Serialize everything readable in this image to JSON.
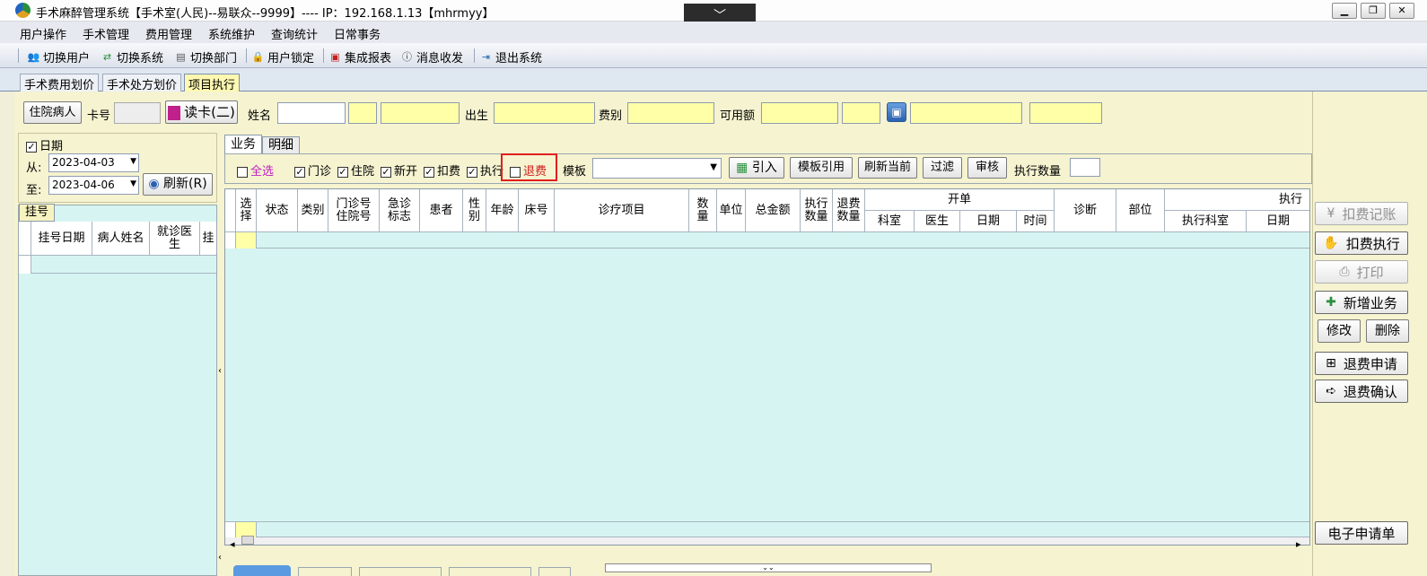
{
  "window": {
    "title": "手术麻醉管理系统【手术室(人民)--易联众--9999】---- IP：192.168.1.13【mhrmyy】",
    "dropdown_glyph": "﹀",
    "controls": [
      "▁",
      "❐",
      "✕"
    ]
  },
  "menu": [
    "用户操作",
    "手术管理",
    "费用管理",
    "系统维护",
    "查询统计",
    "日常事务"
  ],
  "toolbar": [
    {
      "label": "切换用户",
      "icon": "users-icon"
    },
    {
      "label": "切换系统",
      "icon": "switch-system-icon"
    },
    {
      "label": "切换部门",
      "icon": "department-icon"
    },
    {
      "label": "用户锁定",
      "icon": "lock-user-icon"
    },
    {
      "label": "集成报表",
      "icon": "report-icon"
    },
    {
      "label": "消息收发",
      "icon": "message-icon"
    },
    {
      "label": "退出系统",
      "icon": "exit-icon"
    }
  ],
  "main_tabs": [
    "手术费用划价",
    "手术处方划价",
    "项目执行"
  ],
  "patient_bar": {
    "patient_type_button": "住院病人",
    "card_label": "卡号",
    "read_card_button": "读卡(二)",
    "name_label": "姓名",
    "birth_label": "出生",
    "fee_type_label": "费别",
    "available_label": "可用额"
  },
  "date_panel": {
    "date_checkbox": "日期",
    "from_label": "从:",
    "from_value": "2023-04-03",
    "to_label": "至:",
    "to_value": "2023-04-06",
    "refresh_button": "刷新(R)"
  },
  "registration": {
    "tab": "挂号",
    "columns": [
      "挂号日期",
      "病人姓名",
      "就诊医生",
      "挂"
    ]
  },
  "sub_tabs": [
    "业务",
    "明细"
  ],
  "filters": {
    "select_all": "全选",
    "checkboxes": [
      "门诊",
      "住院",
      "新开",
      "扣费",
      "执行"
    ],
    "refund": "退费",
    "template_label": "模板",
    "import_button": "引入",
    "template_ref_button": "模板引用",
    "refresh_current_button": "刷新当前",
    "filter_button": "过滤",
    "audit_button": "审核",
    "exec_count_label": "执行数量"
  },
  "grid": {
    "columns": [
      "选择",
      "状态",
      "类别",
      "门诊号住院号",
      "急诊标志",
      "患者",
      "性别",
      "年龄",
      "床号",
      "诊疗项目",
      "数量",
      "单位",
      "总金额",
      "执行数量",
      "退费数量"
    ],
    "group_order": "开单",
    "order_sub": [
      "科室",
      "医生",
      "日期",
      "时间"
    ],
    "diagnosis": "诊断",
    "site": "部位",
    "group_exec": "执行",
    "exec_sub": [
      "执行科室",
      "日期"
    ]
  },
  "side_buttons": [
    {
      "label": "扣费记账",
      "enabled": false,
      "icon": "yen-icon"
    },
    {
      "label": "扣费执行",
      "enabled": true,
      "icon": "hand-icon"
    },
    {
      "label": "打印",
      "enabled": false,
      "icon": "printer-icon"
    },
    {
      "label": "新增业务",
      "enabled": true,
      "icon": "add-doc-icon"
    },
    {
      "label": "修改",
      "enabled": true
    },
    {
      "label": "删除",
      "enabled": true
    },
    {
      "label": "退费申请",
      "enabled": true,
      "icon": "refund-apply-icon"
    },
    {
      "label": "退费确认",
      "enabled": true,
      "icon": "refund-confirm-icon"
    },
    {
      "label": "电子申请单",
      "enabled": true
    }
  ],
  "colors": {
    "highlight_box": "#e02020",
    "grid_bg": "#d6f5f2",
    "yellow_field": "#ffffa8"
  }
}
